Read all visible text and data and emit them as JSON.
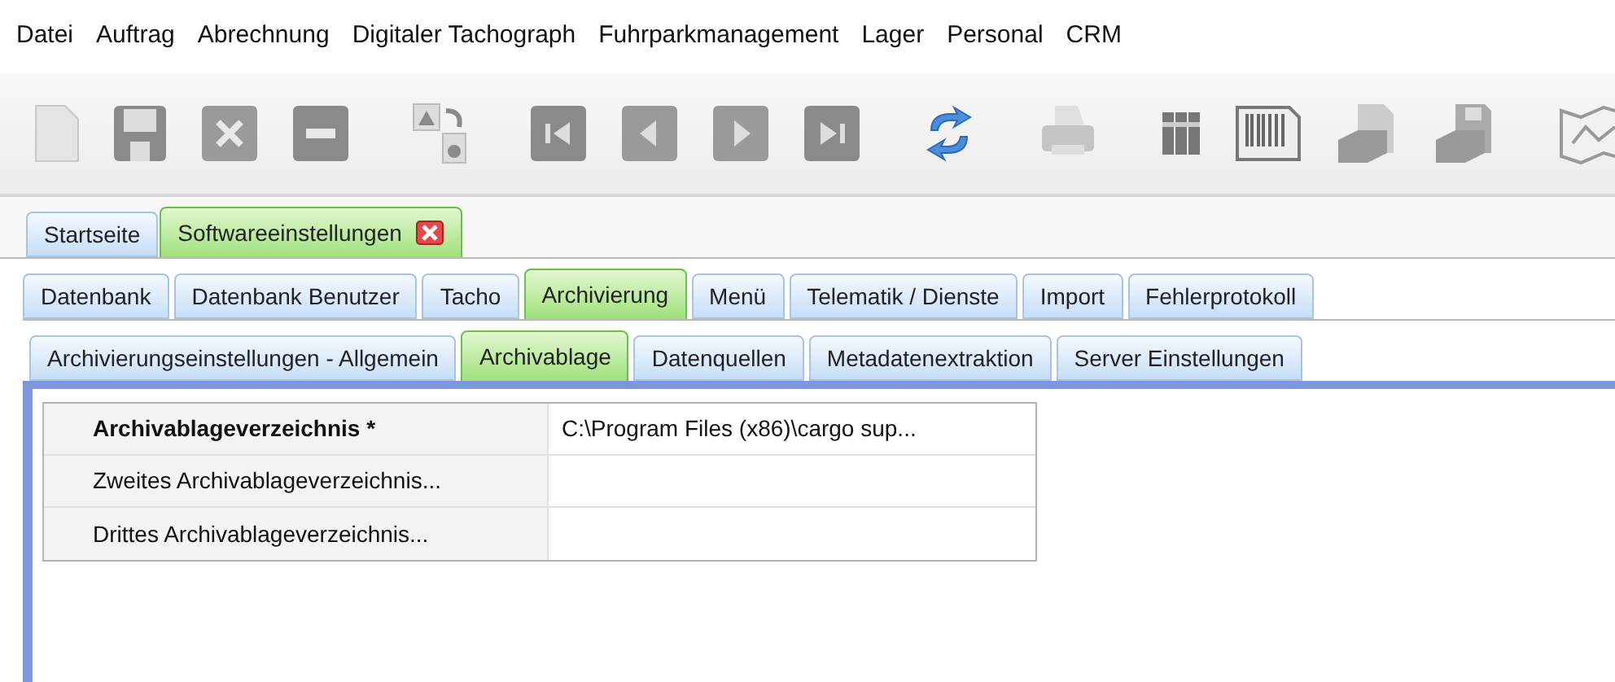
{
  "menu_bar": [
    "Datei",
    "Auftrag",
    "Abrechnung",
    "Digitaler Tachograph",
    "Fuhrparkmanagement",
    "Lager",
    "Personal",
    "CRM"
  ],
  "document_tabs": [
    {
      "label": "Startseite",
      "selected": false,
      "closable": false
    },
    {
      "label": "Softwareeinstellungen",
      "selected": true,
      "closable": true
    }
  ],
  "settings_tabs": [
    {
      "label": "Datenbank",
      "selected": false
    },
    {
      "label": "Datenbank Benutzer",
      "selected": false
    },
    {
      "label": "Tacho",
      "selected": false
    },
    {
      "label": "Archivierung",
      "selected": true
    },
    {
      "label": "Menü",
      "selected": false
    },
    {
      "label": "Telematik / Dienste",
      "selected": false
    },
    {
      "label": "Import",
      "selected": false
    },
    {
      "label": "Fehlerprotokoll",
      "selected": false
    }
  ],
  "archive_tabs": [
    {
      "label": "Archivierungseinstellungen - Allgemein",
      "selected": false
    },
    {
      "label": "Archivablage",
      "selected": true
    },
    {
      "label": "Datenquellen",
      "selected": false
    },
    {
      "label": "Metadatenextraktion",
      "selected": false
    },
    {
      "label": "Server Einstellungen",
      "selected": false
    }
  ],
  "property_grid": [
    {
      "label": "Archivablageverzeichnis *",
      "required": true,
      "value": "C:\\Program Files (x86)\\cargo sup..."
    },
    {
      "label": "Zweites Archivablageverzeichnis...",
      "required": false
    },
    {
      "label": "Drittes Archivablageverzeichnis...",
      "required": false
    }
  ]
}
